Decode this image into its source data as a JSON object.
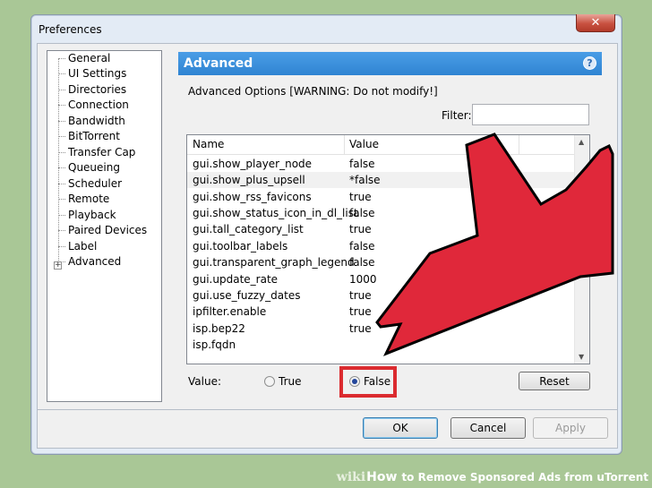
{
  "window": {
    "title": "Preferences",
    "close_symbol": "✕"
  },
  "sidebar": {
    "items": [
      {
        "label": "General"
      },
      {
        "label": "UI Settings"
      },
      {
        "label": "Directories"
      },
      {
        "label": "Connection"
      },
      {
        "label": "Bandwidth"
      },
      {
        "label": "BitTorrent"
      },
      {
        "label": "Transfer Cap"
      },
      {
        "label": "Queueing"
      },
      {
        "label": "Scheduler"
      },
      {
        "label": "Remote"
      },
      {
        "label": "Playback"
      },
      {
        "label": "Paired Devices"
      },
      {
        "label": "Label"
      },
      {
        "label": "Advanced"
      }
    ],
    "expand_symbol": "+"
  },
  "panel": {
    "title": "Advanced",
    "help_symbol": "?",
    "group_label": "Advanced Options [WARNING: Do not modify!]",
    "filter_label": "Filter:",
    "filter_value": ""
  },
  "table": {
    "columns": [
      "Name",
      "Value"
    ],
    "rows": [
      {
        "name": "gui.show_player_node",
        "value": "false"
      },
      {
        "name": "gui.show_plus_upsell",
        "value": "*false"
      },
      {
        "name": "gui.show_rss_favicons",
        "value": "true"
      },
      {
        "name": "gui.show_status_icon_in_dl_list",
        "value": "false"
      },
      {
        "name": "gui.tall_category_list",
        "value": "true"
      },
      {
        "name": "gui.toolbar_labels",
        "value": "false"
      },
      {
        "name": "gui.transparent_graph_legend",
        "value": "false"
      },
      {
        "name": "gui.update_rate",
        "value": "1000"
      },
      {
        "name": "gui.use_fuzzy_dates",
        "value": "true"
      },
      {
        "name": "ipfilter.enable",
        "value": "true"
      },
      {
        "name": "isp.bep22",
        "value": "true"
      },
      {
        "name": "isp.fqdn",
        "value": ""
      }
    ],
    "selected_row": 1
  },
  "value_editor": {
    "label": "Value:",
    "true_label": "True",
    "false_label": "False",
    "selected": "False",
    "reset_label": "Reset"
  },
  "footer": {
    "ok_label": "OK",
    "cancel_label": "Cancel",
    "apply_label": "Apply"
  },
  "watermark": {
    "wiki": "wiki",
    "how": "How",
    "text": "to Remove Sponsored Ads from uTorrent"
  },
  "colors": {
    "header_blue": "#2f84d2",
    "highlight_red": "#db2b2f",
    "arrow_red": "#e0283a",
    "background_green": "#a9c796"
  }
}
